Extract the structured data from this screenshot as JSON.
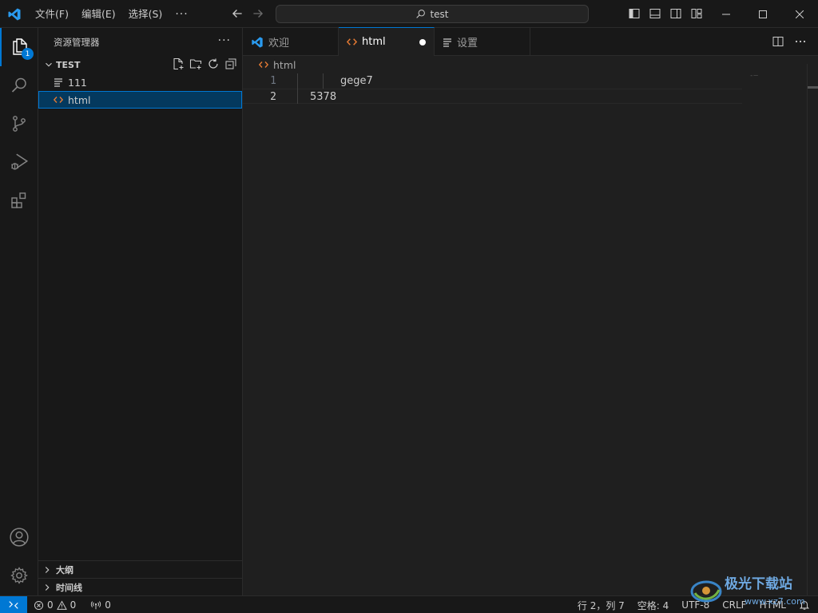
{
  "titlebar": {
    "menu": [
      "文件(F)",
      "编辑(E)",
      "选择(S)"
    ],
    "more": "···",
    "search_text": "test"
  },
  "activity": {
    "explorer_badge": "1"
  },
  "sidebar": {
    "title": "资源管理器",
    "more": "···",
    "folder": "TEST",
    "files": [
      {
        "name": "111",
        "type": "text"
      },
      {
        "name": "html",
        "type": "code"
      }
    ],
    "bottom_panels": [
      "大纲",
      "时间线"
    ]
  },
  "tabs": [
    {
      "label": "欢迎",
      "icon": "vscode-logo-icon"
    },
    {
      "label": "html",
      "icon": "code-icon",
      "dirty": true
    },
    {
      "label": "设置",
      "icon": "settings-file-icon"
    }
  ],
  "breadcrumb": {
    "file": "html"
  },
  "editor": {
    "lines": [
      {
        "number": "1",
        "text": "gege7"
      },
      {
        "number": "2",
        "text": "5378"
      }
    ],
    "minimap_mark": "-‒"
  },
  "statusbar": {
    "errors": "0",
    "warnings": "0",
    "ports": "0",
    "position": "行 2，列 7",
    "spaces": "空格: 4",
    "encoding": "UTF-8",
    "eol": "CRLF",
    "language": "HTML"
  },
  "watermark": {
    "text": "极光下载站",
    "url": "www.xz7.com"
  },
  "colors": {
    "accent": "#0078d4",
    "html_icon": "#e37933"
  }
}
